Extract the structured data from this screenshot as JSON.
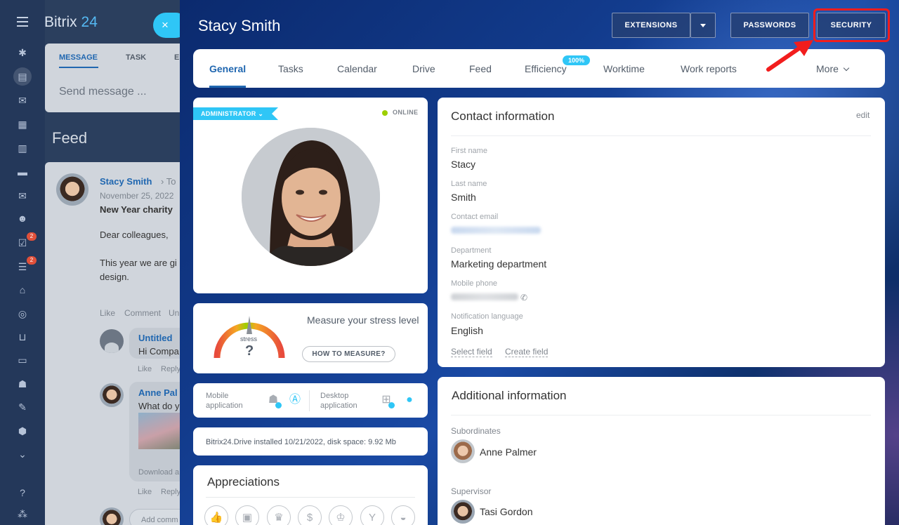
{
  "background": {
    "logo": {
      "brand": "Bitrix",
      "number": "24"
    },
    "close_icon": "×",
    "message_tabs": [
      "MESSAGE",
      "TASK",
      "E"
    ],
    "message_placeholder": "Send message ...",
    "feed_title": "Feed",
    "post": {
      "author": "Stacy Smith",
      "to": "To",
      "date": "November 25, 2022",
      "title": "New Year charity",
      "greeting": "Dear colleagues,",
      "body_line1": "This year we are gi",
      "body_line2": "design.",
      "actions": [
        "Like",
        "Comment",
        "Un"
      ]
    },
    "comments": [
      {
        "author": "Untitled",
        "text": "Hi Compa",
        "actions": [
          "Like",
          "Reply"
        ]
      },
      {
        "author": "Anne Pal",
        "text": "What do y",
        "extra": "Download a",
        "actions": [
          "Like",
          "Reply"
        ]
      }
    ],
    "add_comment": "Add comm",
    "rail_badges": [
      "2",
      "2"
    ]
  },
  "profile": {
    "name": "Stacy Smith",
    "buttons": {
      "extensions": "EXTENSIONS",
      "passwords": "PASSWORDS",
      "security": "SECURITY"
    },
    "tabs": [
      {
        "label": "General",
        "active": true
      },
      {
        "label": "Tasks"
      },
      {
        "label": "Calendar"
      },
      {
        "label": "Drive"
      },
      {
        "label": "Feed"
      },
      {
        "label": "Efficiency",
        "badge": "100%"
      },
      {
        "label": "Worktime"
      },
      {
        "label": "Work reports"
      },
      {
        "label": "More"
      }
    ],
    "photo_card": {
      "role": "ADMINISTRATOR",
      "status": "ONLINE"
    },
    "stress": {
      "title": "Measure your stress level",
      "gauge_label": "stress",
      "gauge_value": "?",
      "button": "HOW TO MEASURE?"
    },
    "apps": {
      "mobile": [
        "Mobile",
        "application"
      ],
      "desktop": [
        "Desktop",
        "application"
      ]
    },
    "drive_info": "Bitrix24.Drive installed 10/21/2022, disk space: 9.92 Mb",
    "appreciations": {
      "title": "Appreciations",
      "icons": [
        "thumbs-up-icon",
        "gift-icon",
        "trophy-icon",
        "money-bag-icon",
        "crown-icon",
        "cocktail-icon",
        "cake-icon"
      ]
    },
    "contact": {
      "title": "Contact information",
      "edit": "edit",
      "fields": {
        "first_name": {
          "label": "First name",
          "value": "Stacy"
        },
        "last_name": {
          "label": "Last name",
          "value": "Smith"
        },
        "email": {
          "label": "Contact email"
        },
        "department": {
          "label": "Department",
          "value": "Marketing department"
        },
        "mobile": {
          "label": "Mobile phone"
        },
        "language": {
          "label": "Notification language",
          "value": "English"
        }
      },
      "select_field": "Select field",
      "create_field": "Create field"
    },
    "additional": {
      "title": "Additional information",
      "subordinates_label": "Subordinates",
      "subordinate": "Anne Palmer",
      "supervisor_label": "Supervisor",
      "supervisor": "Tasi Gordon"
    }
  },
  "colors": {
    "accent": "#2fc6f6",
    "link": "#2067b0",
    "highlight": "#f21d1d",
    "online": "#9dcf00"
  }
}
